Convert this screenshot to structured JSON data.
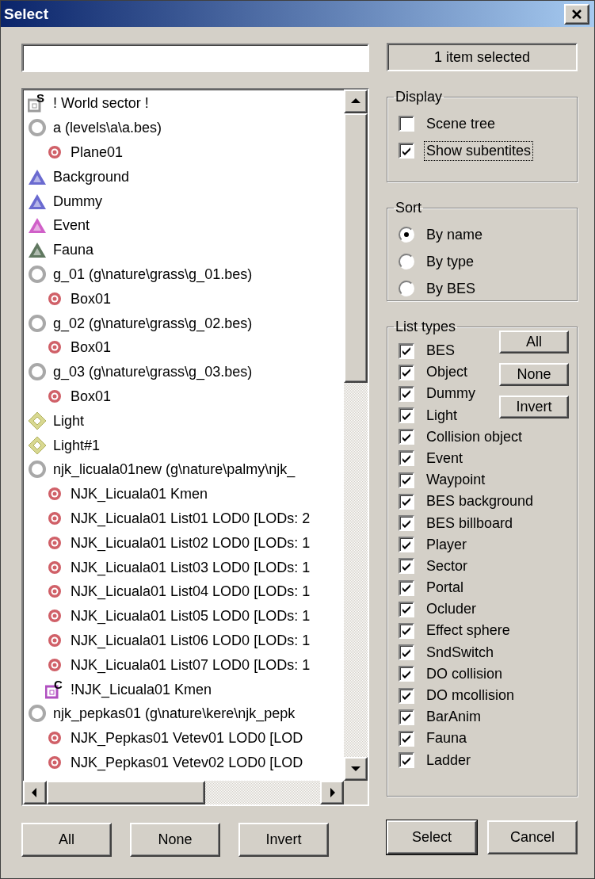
{
  "window": {
    "title": "Select"
  },
  "status": "1 item selected",
  "tree": [
    {
      "label": "! World sector !",
      "kind": "sector",
      "letter": "S"
    },
    {
      "label": "a (levels\\a\\a.bes)",
      "kind": "bes",
      "children": [
        {
          "label": "Plane01",
          "kind": "mesh"
        }
      ]
    },
    {
      "label": "Background",
      "kind": "marker",
      "color": "#6a6ad0"
    },
    {
      "label": "Dummy",
      "kind": "marker",
      "color": "#6a6ad0"
    },
    {
      "label": "Event",
      "kind": "marker",
      "color": "#d060c8"
    },
    {
      "label": "Fauna",
      "kind": "marker",
      "color": "#607860"
    },
    {
      "label": "g_01 (g\\nature\\grass\\g_01.bes)",
      "kind": "bes",
      "children": [
        {
          "label": "Box01",
          "kind": "mesh"
        }
      ]
    },
    {
      "label": "g_02 (g\\nature\\grass\\g_02.bes)",
      "kind": "bes",
      "children": [
        {
          "label": "Box01",
          "kind": "mesh"
        }
      ]
    },
    {
      "label": "g_03 (g\\nature\\grass\\g_03.bes)",
      "kind": "bes",
      "children": [
        {
          "label": "Box01",
          "kind": "mesh"
        }
      ]
    },
    {
      "label": "Light",
      "kind": "light"
    },
    {
      "label": "Light#1",
      "kind": "light"
    },
    {
      "label": "njk_licuala01new (g\\nature\\palmy\\njk_",
      "kind": "bes",
      "children": [
        {
          "label": "NJK_Licuala01 Kmen",
          "kind": "mesh"
        },
        {
          "label": "NJK_Licuala01 List01 LOD0 [LODs: 2",
          "kind": "mesh"
        },
        {
          "label": "NJK_Licuala01 List02 LOD0 [LODs: 1",
          "kind": "mesh"
        },
        {
          "label": "NJK_Licuala01 List03 LOD0 [LODs: 1",
          "kind": "mesh"
        },
        {
          "label": "NJK_Licuala01 List04 LOD0 [LODs: 1",
          "kind": "mesh"
        },
        {
          "label": "NJK_Licuala01 List05 LOD0 [LODs: 1",
          "kind": "mesh"
        },
        {
          "label": "NJK_Licuala01 List06 LOD0 [LODs: 1",
          "kind": "mesh"
        },
        {
          "label": "NJK_Licuala01 List07 LOD0 [LODs: 1",
          "kind": "mesh"
        },
        {
          "label": "!NJK_Licuala01 Kmen",
          "kind": "collision",
          "letter": "C"
        }
      ]
    },
    {
      "label": "njk_pepkas01 (g\\nature\\kere\\njk_pepk",
      "kind": "bes",
      "children": [
        {
          "label": "NJK_Pepkas01 Vetev01 LOD0 [LOD",
          "kind": "mesh"
        },
        {
          "label": "NJK_Pepkas01 Vetev02 LOD0 [LOD",
          "kind": "mesh"
        }
      ]
    }
  ],
  "list_buttons": [
    "All",
    "None",
    "Invert"
  ],
  "display": {
    "title": "Display",
    "options": [
      {
        "label": "Scene tree",
        "checked": false,
        "focused": false
      },
      {
        "label": "Show subentites",
        "checked": true,
        "focused": true
      }
    ]
  },
  "sort": {
    "title": "Sort",
    "options": [
      {
        "label": "By name",
        "selected": true
      },
      {
        "label": "By type",
        "selected": false
      },
      {
        "label": "By BES",
        "selected": false
      }
    ]
  },
  "list_types": {
    "title": "List types",
    "buttons": [
      "All",
      "None",
      "Invert"
    ],
    "options": [
      {
        "label": "BES",
        "checked": true
      },
      {
        "label": "Object",
        "checked": true
      },
      {
        "label": "Dummy",
        "checked": true
      },
      {
        "label": "Light",
        "checked": true
      },
      {
        "label": "Collision object",
        "checked": true
      },
      {
        "label": "Event",
        "checked": true
      },
      {
        "label": "Waypoint",
        "checked": true
      },
      {
        "label": "BES background",
        "checked": true
      },
      {
        "label": "BES billboard",
        "checked": true
      },
      {
        "label": "Player",
        "checked": true
      },
      {
        "label": "Sector",
        "checked": true
      },
      {
        "label": "Portal",
        "checked": true
      },
      {
        "label": "Ocluder",
        "checked": true
      },
      {
        "label": "Effect sphere",
        "checked": true
      },
      {
        "label": "SndSwitch",
        "checked": true
      },
      {
        "label": "DO collision",
        "checked": true
      },
      {
        "label": "DO mcollision",
        "checked": true
      },
      {
        "label": "BarAnim",
        "checked": true
      },
      {
        "label": "Fauna",
        "checked": true
      },
      {
        "label": "Ladder",
        "checked": true
      }
    ]
  },
  "dialog_buttons": [
    {
      "label": "Select",
      "default": true
    },
    {
      "label": "Cancel",
      "default": false
    }
  ]
}
